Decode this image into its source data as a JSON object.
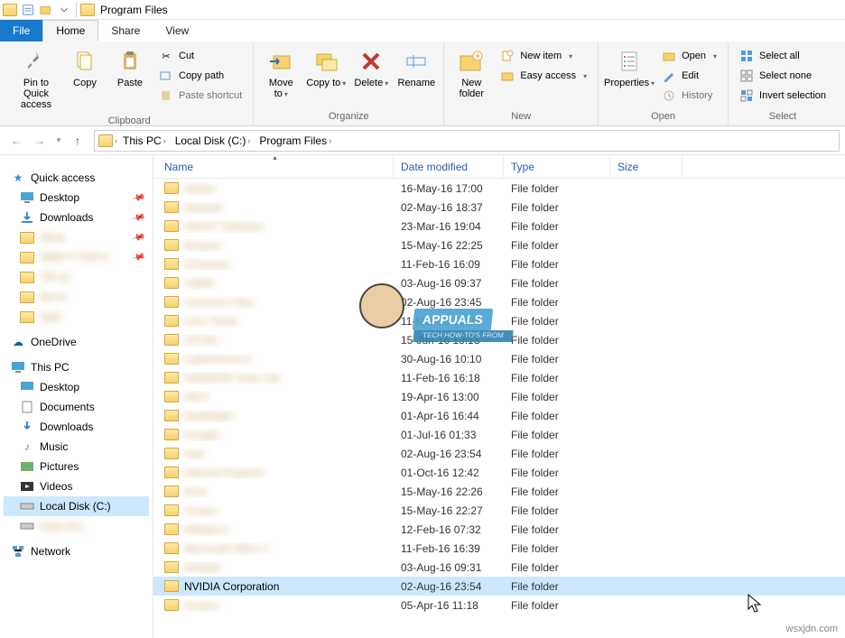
{
  "titlebar": {
    "title": "Program Files"
  },
  "tabs": {
    "file": "File",
    "home": "Home",
    "share": "Share",
    "view": "View"
  },
  "ribbon": {
    "clipboard": {
      "pin": "Pin to Quick access",
      "copy": "Copy",
      "paste": "Paste",
      "cut": "Cut",
      "copy_path": "Copy path",
      "paste_shortcut": "Paste shortcut",
      "label": "Clipboard"
    },
    "organize": {
      "move_to": "Move to",
      "copy_to": "Copy to",
      "delete": "Delete",
      "rename": "Rename",
      "label": "Organize"
    },
    "new": {
      "new_folder": "New folder",
      "new_item": "New item",
      "easy_access": "Easy access",
      "label": "New"
    },
    "open": {
      "properties": "Properties",
      "open": "Open",
      "edit": "Edit",
      "history": "History",
      "label": "Open"
    },
    "select": {
      "select_all": "Select all",
      "select_none": "Select none",
      "invert": "Invert selection",
      "label": "Select"
    }
  },
  "breadcrumb": {
    "this_pc": "This PC",
    "local_disk": "Local Disk (C:)",
    "program_files": "Program Files"
  },
  "tree": {
    "quick_access": "Quick access",
    "desktop": "Desktop",
    "downloads": "Downloads",
    "onedrive": "OneDrive",
    "this_pc": "This PC",
    "documents": "Documents",
    "music": "Music",
    "pictures": "Pictures",
    "videos": "Videos",
    "local_disk": "Local Disk (C:)",
    "network": "Network"
  },
  "columns": {
    "name": "Name",
    "date": "Date modified",
    "type": "Type",
    "size": "Size"
  },
  "files": [
    {
      "name": "Adobe",
      "date": "16-May-16 17:00",
      "type": "File folder",
      "blur": true
    },
    {
      "name": "Android",
      "date": "02-May-16 18:37",
      "type": "File folder",
      "blur": true
    },
    {
      "name": "AVAST Software",
      "date": "23-Mar-16 19:04",
      "type": "File folder",
      "blur": true
    },
    {
      "name": "Bonjour",
      "date": "15-May-16 22:25",
      "type": "File folder",
      "blur": true
    },
    {
      "name": "CCleaner",
      "date": "11-Feb-16 16:09",
      "type": "File folder",
      "blur": true
    },
    {
      "name": "CMAK",
      "date": "03-Aug-16 09:37",
      "type": "File folder",
      "blur": true
    },
    {
      "name": "Common Files",
      "date": "02-Aug-16 23:45",
      "type": "File folder",
      "blur": true
    },
    {
      "name": "Core Temp",
      "date": "11-Mar-16 13:01",
      "type": "File folder",
      "blur": true
    },
    {
      "name": "CPUID",
      "date": "15-Jun-16 13:13",
      "type": "File folder",
      "blur": true
    },
    {
      "name": "CyberGhost 5",
      "date": "30-Aug-16 10:10",
      "type": "File folder",
      "blur": true
    },
    {
      "name": "DAEMON Tools Lite",
      "date": "11-Feb-16 16:18",
      "type": "File folder",
      "blur": true
    },
    {
      "name": "DIFX",
      "date": "19-Apr-16 13:00",
      "type": "File folder",
      "blur": true
    },
    {
      "name": "DraftSight",
      "date": "01-Apr-16 16:44",
      "type": "File folder",
      "blur": true
    },
    {
      "name": "Google",
      "date": "01-Jul-16 01:33",
      "type": "File folder",
      "blur": true
    },
    {
      "name": "Intel",
      "date": "02-Aug-16 23:54",
      "type": "File folder",
      "blur": true
    },
    {
      "name": "Internet Explorer",
      "date": "01-Oct-16 12:42",
      "type": "File folder",
      "blur": true
    },
    {
      "name": "iPod",
      "date": "15-May-16 22:26",
      "type": "File folder",
      "blur": true
    },
    {
      "name": "iTunes",
      "date": "15-May-16 22:27",
      "type": "File folder",
      "blur": true
    },
    {
      "name": "KMSpico",
      "date": "12-Feb-16 07:32",
      "type": "File folder",
      "blur": true
    },
    {
      "name": "Microsoft Office 1",
      "date": "11-Feb-16 16:39",
      "type": "File folder",
      "blur": true
    },
    {
      "name": "NVIDIA",
      "date": "03-Aug-16 09:31",
      "type": "File folder",
      "blur": true
    },
    {
      "name": "NVIDIA Corporation",
      "date": "02-Aug-16 23:54",
      "type": "File folder",
      "blur": false,
      "selected": true
    },
    {
      "name": "Oculus",
      "date": "05-Apr-16 11:18",
      "type": "File folder",
      "blur": true
    }
  ],
  "watermark": "wsxjdn.com",
  "overlay": {
    "brand": "APPUALS",
    "tagline": "TECH HOW-TO'S FROM"
  }
}
